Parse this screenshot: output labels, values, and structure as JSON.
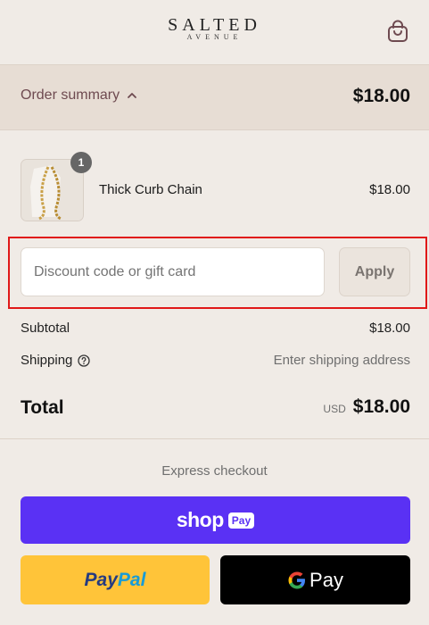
{
  "header": {
    "brand_main": "SALTED",
    "brand_sub": "AVENUE",
    "cart_icon": "shopping-bag-icon"
  },
  "summary": {
    "toggle_label": "Order summary",
    "toggle_icon": "chevron-up-icon",
    "total": "$18.00"
  },
  "line_items": [
    {
      "name": "Thick Curb Chain",
      "price": "$18.00",
      "quantity": "1"
    }
  ],
  "discount": {
    "placeholder": "Discount code or gift card",
    "value": "",
    "apply_label": "Apply"
  },
  "totals": {
    "subtotal_label": "Subtotal",
    "subtotal_value": "$18.00",
    "shipping_label": "Shipping",
    "shipping_value": "Enter shipping address",
    "total_label": "Total",
    "currency": "USD",
    "total_value": "$18.00"
  },
  "express": {
    "heading": "Express checkout",
    "shop_text": "shop",
    "shop_badge": "Pay",
    "paypal_a": "Pay",
    "paypal_b": "Pal",
    "gpay_text": "Pay"
  },
  "colors": {
    "page_bg": "#f0ebe6",
    "summary_bg": "#e7ddd4",
    "shop_pay": "#5a31f4",
    "paypal": "#ffc439",
    "gpay": "#000000",
    "highlight": "#e01818"
  }
}
